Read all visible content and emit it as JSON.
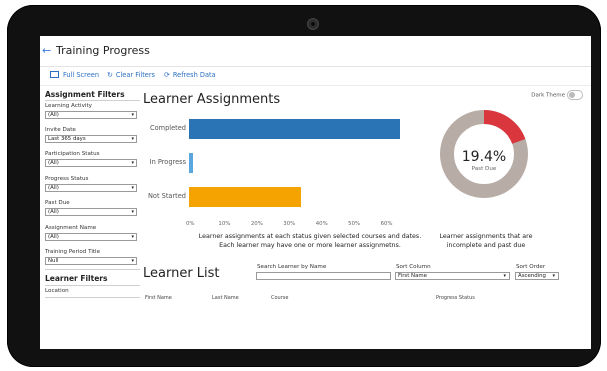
{
  "header": {
    "back_glyph": "←",
    "title": "Training Progress"
  },
  "toolbar": {
    "full_screen": "Full Screen",
    "clear_filters": "Clear Filters",
    "refresh_data": "Refresh Data"
  },
  "sidebar": {
    "assignment_heading": "Assignment Filters",
    "filters": [
      {
        "label": "Learning Activity",
        "value": "(All)"
      },
      {
        "label": "Invite Date",
        "value": "Last 365 days"
      },
      {
        "label": "Participation Status",
        "value": "(All)"
      },
      {
        "label": "Progress Status",
        "value": "(All)"
      },
      {
        "label": "Past Due",
        "value": "(All)"
      },
      {
        "label": "Assignment Name",
        "value": "(All)"
      },
      {
        "label": "Training Period Title",
        "value": "Null"
      }
    ],
    "learner_heading": "Learner Filters",
    "location_label": "Location"
  },
  "assignments": {
    "heading": "Learner Assignments",
    "dark_theme_label": "Dark Theme",
    "caption_line1": "Learner assignments at each status given selected courses and dates.",
    "caption_line2": "Each learner may have one or more learner assignmetns."
  },
  "chart_data": {
    "type": "bar",
    "orientation": "horizontal",
    "categories": [
      "Completed",
      "In Progress",
      "Not Started"
    ],
    "values": [
      65.0,
      1.2,
      34.5
    ],
    "colors": [
      "#2a73b5",
      "#5aa7e0",
      "#f5a300"
    ],
    "x_ticks": [
      "0%",
      "10%",
      "20%",
      "30%",
      "40%",
      "50%",
      "60%"
    ],
    "xlim": [
      0,
      70
    ],
    "grid": false
  },
  "donut": {
    "percent_text": "19.4%",
    "sub_label": "Past Due",
    "fraction": 0.194,
    "highlight_color": "#d9363e",
    "base_color": "#b8aca6",
    "caption_line1": "Learner assignments that are",
    "caption_line2": "incomplete and past due"
  },
  "learner_list": {
    "heading": "Learner List",
    "search_label": "Search Learner by Name",
    "search_value": "",
    "sort_column_label": "Sort Column",
    "sort_column_value": "First Name",
    "sort_order_label": "Sort Order",
    "sort_order_value": "Ascending",
    "columns": [
      "First Name",
      "Last Name",
      "Course",
      "Progress Status"
    ]
  }
}
